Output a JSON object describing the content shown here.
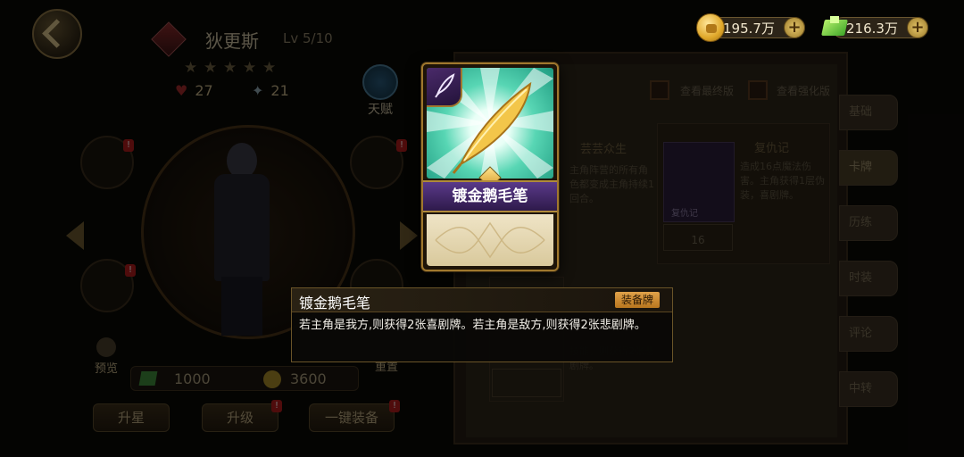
{
  "character": {
    "name": "狄更斯",
    "level": "Lv 5/10",
    "hp": "27",
    "attack": "21",
    "talent_label": "天赋"
  },
  "currency": {
    "coins": "195.7万",
    "gems": "216.3万"
  },
  "costs": {
    "gems": "1000",
    "coins": "3600"
  },
  "left_actions": {
    "preview": "预览",
    "reset": "重置",
    "star_up": "升星",
    "level_up": "升级",
    "auto_equip": "一键装备"
  },
  "right_panel": {
    "checkbox_final": "查看最终版",
    "checkbox_enhanced": "查看强化版",
    "tabs": [
      "基础",
      "卡牌",
      "历练",
      "时装",
      "评论",
      "中转"
    ],
    "card_list": [
      {
        "title": "芸芸众生",
        "desc": "主角阵营的所有角色都变成主角持续1回合。"
      },
      {
        "title": "复仇记",
        "desc": "造成16点魔法伤害。主角获得1层伪装，喜剧牌。",
        "level": "16",
        "art_label": "复仇记"
      },
      {
        "desc": "技能，则获得2张悲剧牌。"
      }
    ]
  },
  "card_detail": {
    "name": "镀金鹅毛笔",
    "type_icon": "quill-icon",
    "tag": "装备牌",
    "description": "若主角是我方,则获得2张喜剧牌。若主角是敌方,则获得2张悲剧牌。"
  },
  "colors": {
    "card_art_bg": "#58d6b4",
    "card_name_banner": "#4a2e72",
    "tag_bg": "#d08e34",
    "gold_border": "#a0782e"
  }
}
